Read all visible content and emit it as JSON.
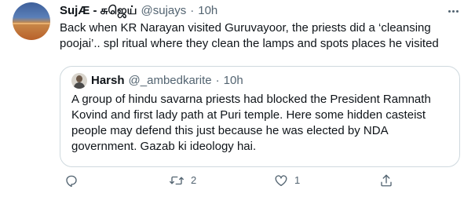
{
  "tweet": {
    "author": {
      "display_name": "SujÆ - சுஜெய்",
      "handle": "@sujays",
      "separator": "·",
      "time": "10h"
    },
    "text": "Back when KR Narayan visited Guruvayoor, the priests did a ‘cleansing poojai’.. spl ritual where they clean the lamps and spots places he visited",
    "quote": {
      "display_name": "Harsh",
      "handle": "@_ambedkarite",
      "separator": "·",
      "time": "10h",
      "text": "A group of hindu savarna priests had blocked the President Ramnath Kovind and first lady path at Puri temple. Here some hidden casteist people may defend this just because he was elected by NDA government. Gazab ki ideology hai."
    },
    "actions": {
      "reply_count": "",
      "retweet_count": "2",
      "like_count": "1"
    }
  },
  "icons": {
    "more": "more-horizontal-icon",
    "reply": "reply-icon",
    "retweet": "retweet-icon",
    "like": "heart-icon",
    "share": "share-icon"
  },
  "colors": {
    "text": "#0f1419",
    "secondary": "#536471",
    "border": "#cfd9de"
  }
}
